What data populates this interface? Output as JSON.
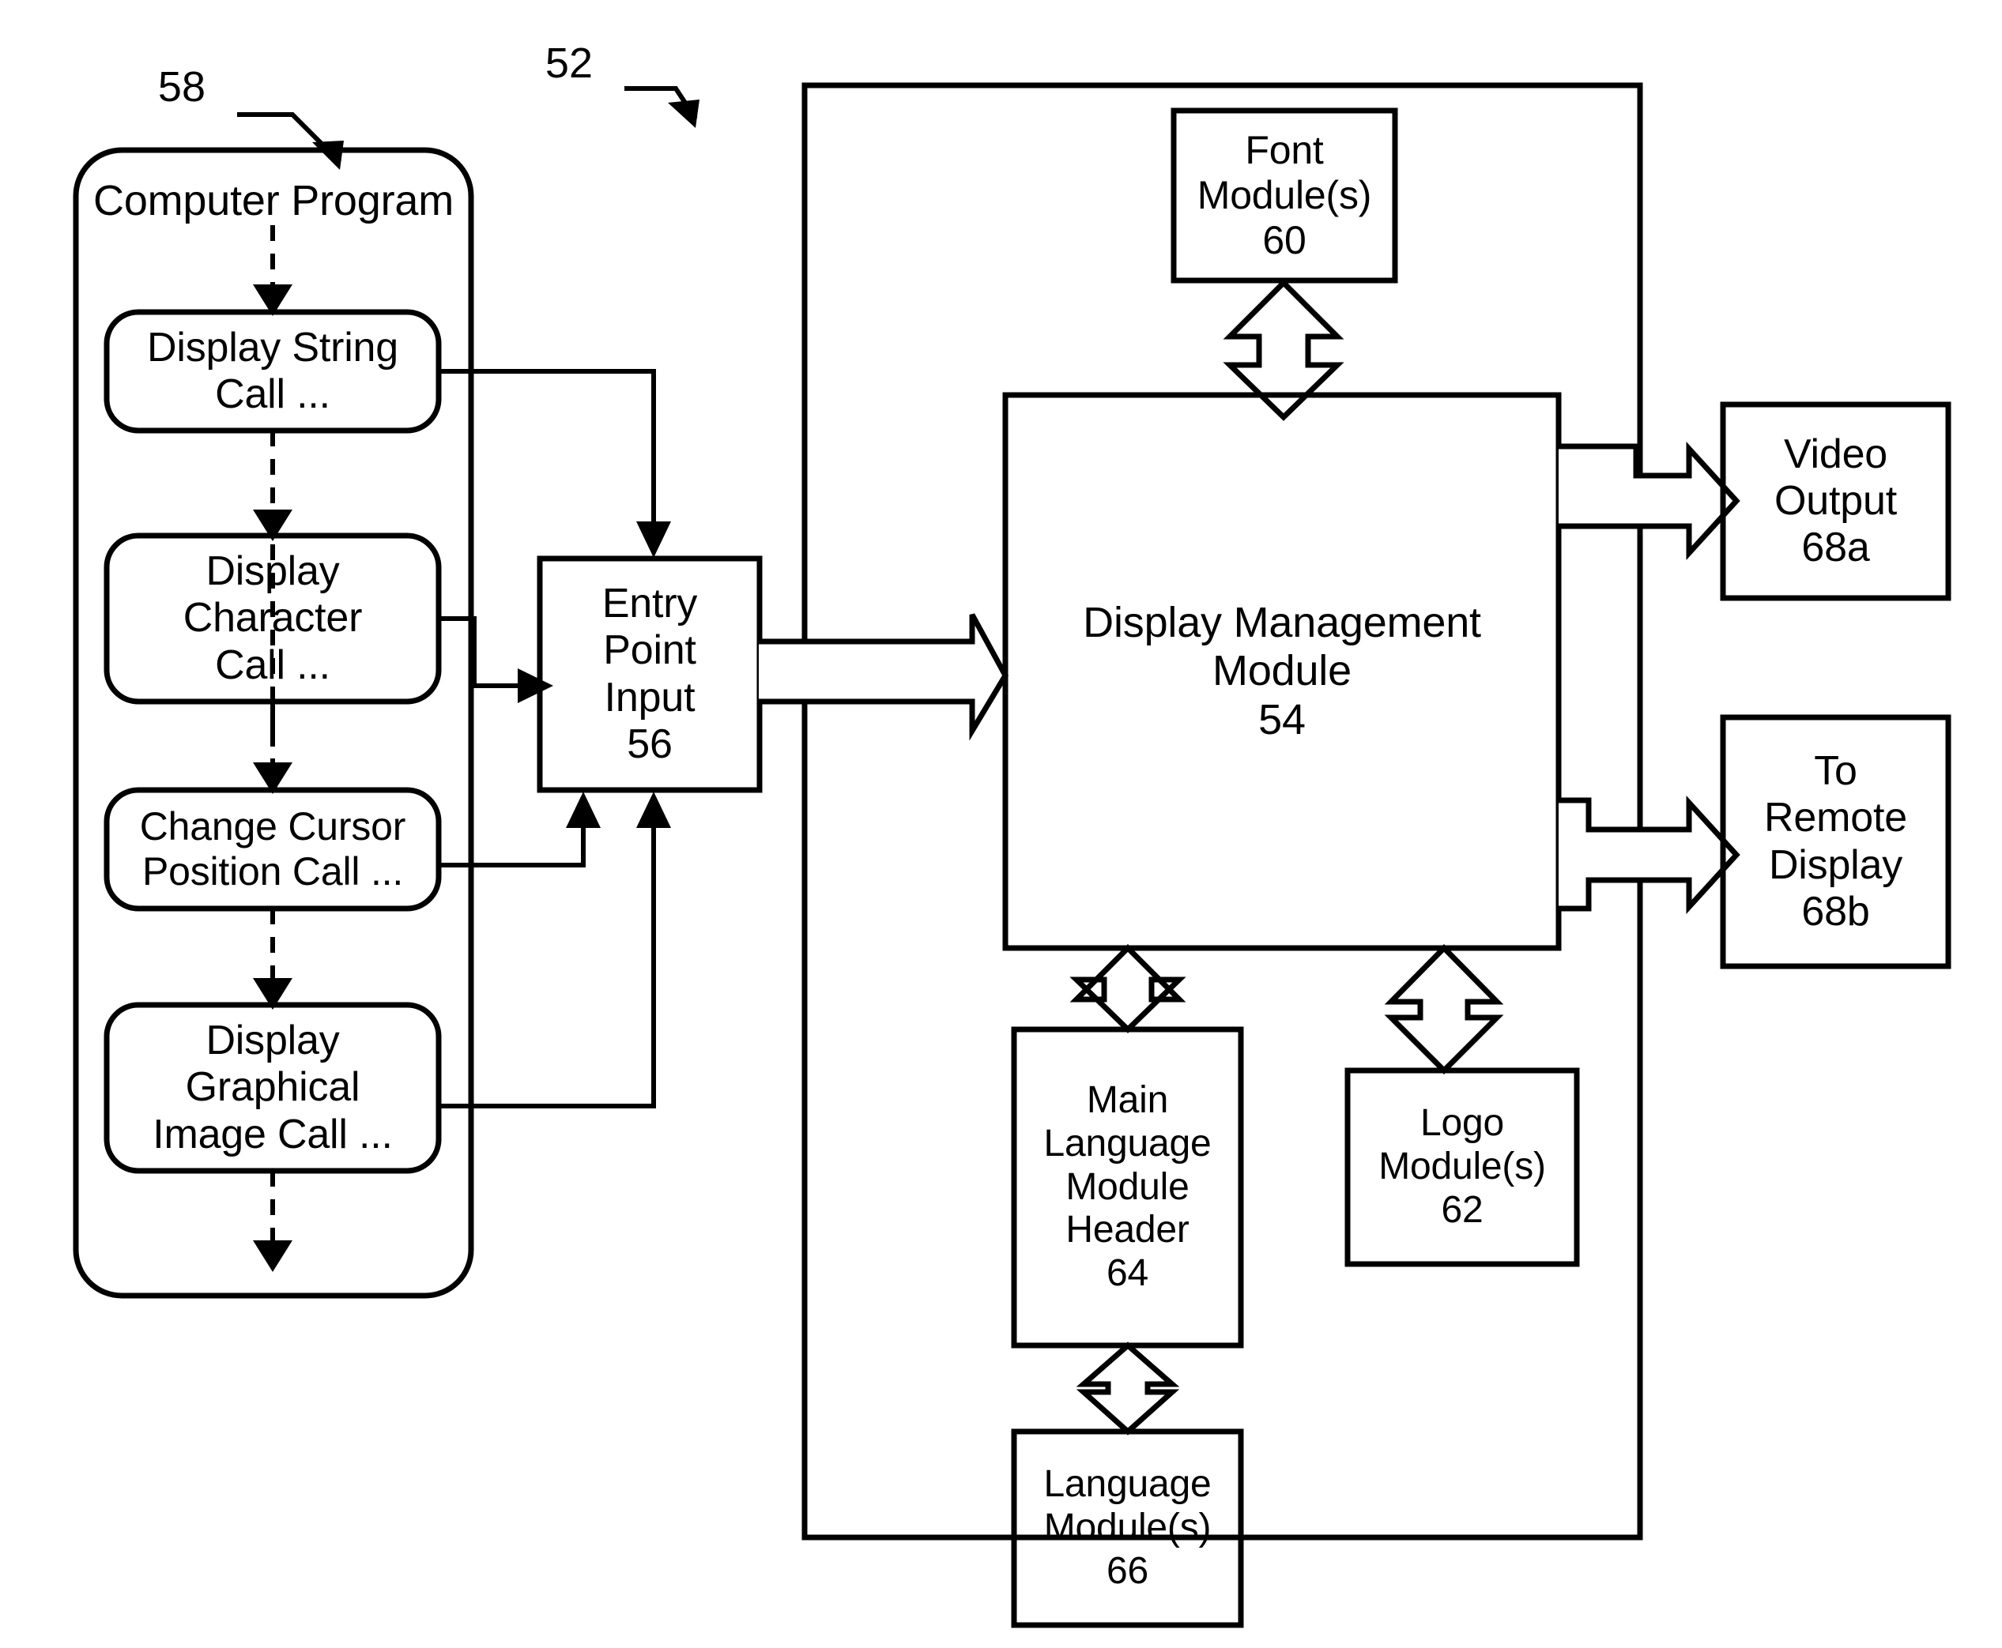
{
  "figure": {
    "type": "patent-block-diagram",
    "reference_labels": [
      {
        "id": "label-58",
        "text": "58"
      },
      {
        "id": "label-52",
        "text": "52"
      }
    ]
  },
  "left_panel": {
    "title": "Computer Program",
    "ref": "58",
    "calls": [
      {
        "id": "display-string-call",
        "lines": [
          "Display String",
          "Call ..."
        ]
      },
      {
        "id": "display-character-call",
        "lines": [
          "Display",
          "Character",
          "Call ..."
        ]
      },
      {
        "id": "change-cursor-position-call",
        "lines": [
          "Change Cursor",
          "Position Call ..."
        ]
      },
      {
        "id": "display-graphical-image-call",
        "lines": [
          "Display",
          "Graphical",
          "Image Call ..."
        ]
      }
    ]
  },
  "entry_point": {
    "lines": [
      "Entry",
      "Point",
      "Input"
    ],
    "ref": "56"
  },
  "system": {
    "ref": "52",
    "font_module": {
      "lines": [
        "Font",
        "Module(s)"
      ],
      "ref": "60"
    },
    "display_management_module": {
      "lines": [
        "Display Management",
        "Module"
      ],
      "ref": "54"
    },
    "main_language_module_header": {
      "lines": [
        "Main",
        "Language",
        "Module",
        "Header"
      ],
      "ref": "64"
    },
    "language_modules": {
      "lines": [
        "Language",
        "Module(s)"
      ],
      "ref": "66"
    },
    "logo_modules": {
      "lines": [
        "Logo",
        "Module(s)"
      ],
      "ref": "62"
    }
  },
  "outputs": [
    {
      "id": "video-output",
      "lines": [
        "Video",
        "Output"
      ],
      "ref": "68a"
    },
    {
      "id": "remote-display-output",
      "lines": [
        "To",
        "Remote",
        "Display"
      ],
      "ref": "68b"
    }
  ],
  "colors": {
    "stroke": "#000000",
    "background": "#ffffff"
  }
}
